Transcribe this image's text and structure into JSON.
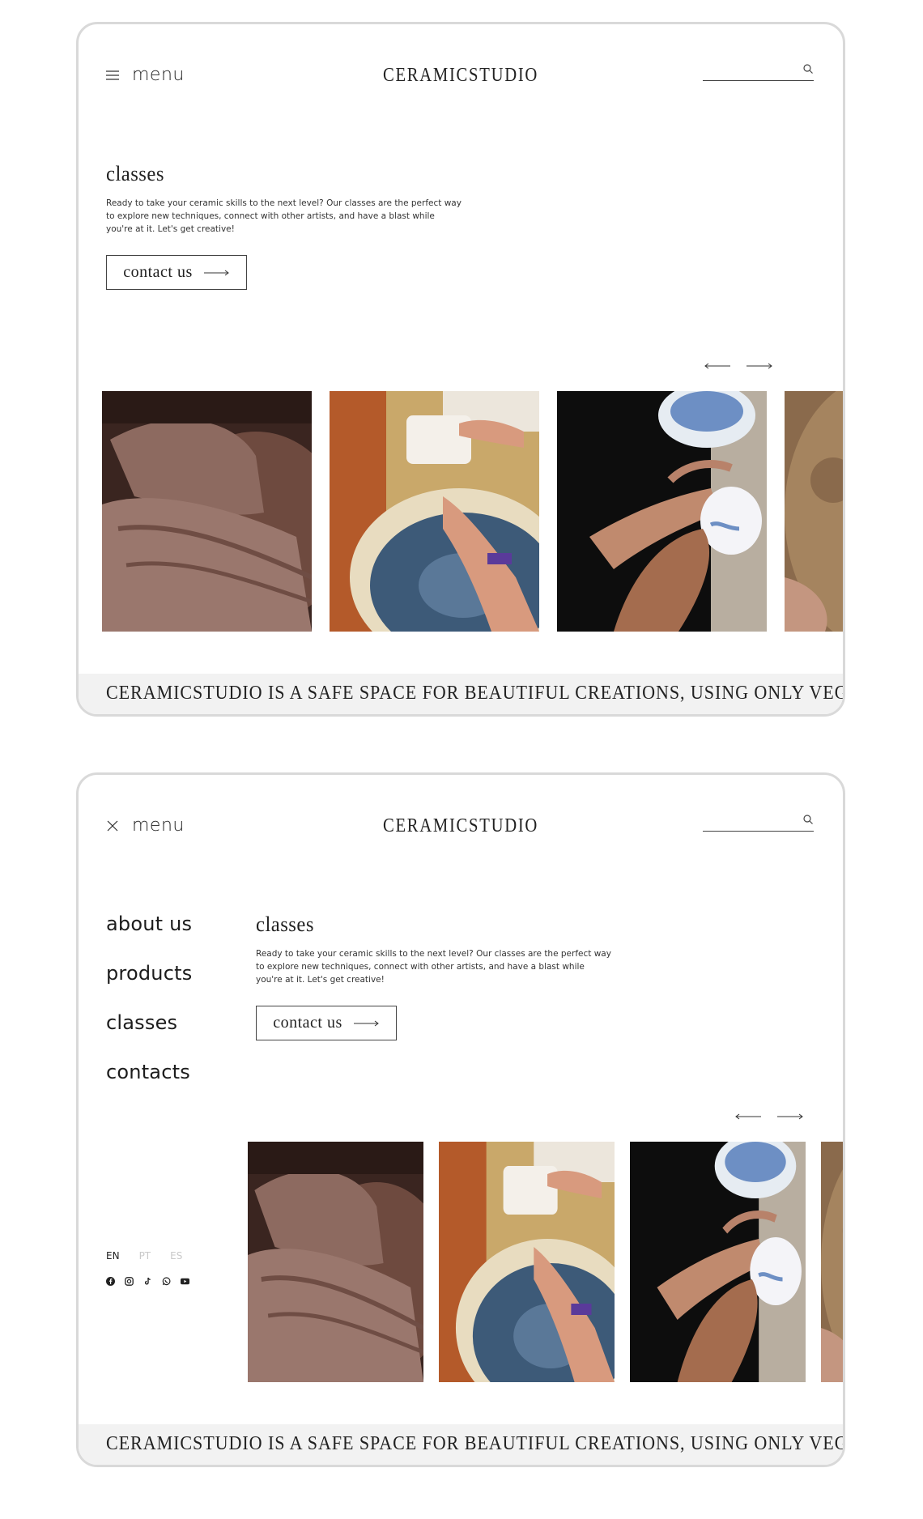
{
  "screens": [
    {
      "menu": {
        "label": "menu",
        "state": "closed"
      },
      "brand": "CERAMICSTUDIO",
      "search": {
        "value": "",
        "placeholder": ""
      },
      "hero": {
        "title": "classes",
        "description": "Ready to take your ceramic skills to the next level? Our classes are the perfect way to explore new techniques, connect with other artists, and have a blast while you're at it. Let's get creative!",
        "cta_label": "contact us"
      },
      "marquee": "CERAMICSTUDIO IS A SAFE SPACE FOR BEAUTIFUL CREATIONS, USING ONLY VEGAN MATI"
    },
    {
      "menu": {
        "label": "menu",
        "state": "open"
      },
      "brand": "CERAMICSTUDIO",
      "search": {
        "value": "",
        "placeholder": ""
      },
      "nav": [
        "about us",
        "products",
        "classes",
        "contacts"
      ],
      "languages": [
        {
          "code": "EN",
          "active": true
        },
        {
          "code": "PT",
          "active": false
        },
        {
          "code": "ES",
          "active": false
        }
      ],
      "socials": [
        "facebook-icon",
        "instagram-icon",
        "tiktok-icon",
        "whatsapp-icon",
        "youtube-icon"
      ],
      "hero": {
        "title": "classes",
        "description": "Ready to take your ceramic skills to the next level? Our classes are the perfect way to explore new techniques, connect with other artists, and have a blast while you're at it. Let's get creative!",
        "cta_label": "contact us"
      },
      "marquee": "CERAMICSTUDIO IS A SAFE SPACE FOR BEAUTIFUL CREATIONS, USING ONLY VEGAN MATI"
    }
  ],
  "gallery_images": [
    "hands-shaping-clay-photo",
    "pottery-wheel-throwing-photo",
    "painting-bowl-photo",
    "carved-clay-plate-photo"
  ],
  "colors": {
    "text": "#1a1a1a",
    "muted": "#c9c9c9",
    "marquee_bg": "#f2f2f2",
    "frame_border": "#d9d9d9"
  }
}
